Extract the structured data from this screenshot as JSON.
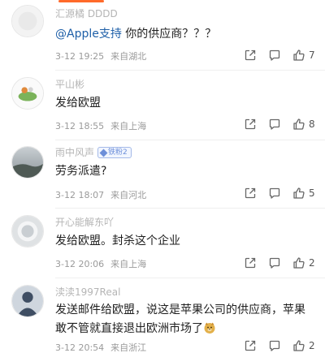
{
  "comments": [
    {
      "username": "汇源橘 DDDD",
      "mention": "@Apple支持",
      "text": " 你的供应商？？？",
      "date": "3-12 19:25",
      "location": "来自湖北",
      "likes": "7"
    },
    {
      "username": "平山彬",
      "text": "发给欧盟",
      "date": "3-12 18:55",
      "location": "来自上海",
      "likes": "8"
    },
    {
      "username": "雨中风声",
      "badge": "铁粉2",
      "text": "劳务派遣?",
      "date": "3-12 18:07",
      "location": "来自河北",
      "likes": "5"
    },
    {
      "username": "开心能解东吖",
      "text": "发给欧盟。封杀这个企业",
      "date": "3-12 20:06",
      "location": "来自上海",
      "likes": "2"
    },
    {
      "username": "渎渎1997Real",
      "text": "发送邮件给欧盟，说这是苹果公司的供应商，苹果敢不管就直接退出欧洲市场了",
      "date": "3-12 20:54",
      "location": "来自浙江",
      "likes": "2"
    }
  ],
  "icons": {
    "share": "share-icon",
    "reply": "comment-icon",
    "like": "thumbs-up-icon"
  },
  "colors": {
    "accent": "#ff6a2a",
    "mention": "#1e5fa8",
    "meta": "#9a9a9a",
    "badge": "#6d8fd9"
  }
}
